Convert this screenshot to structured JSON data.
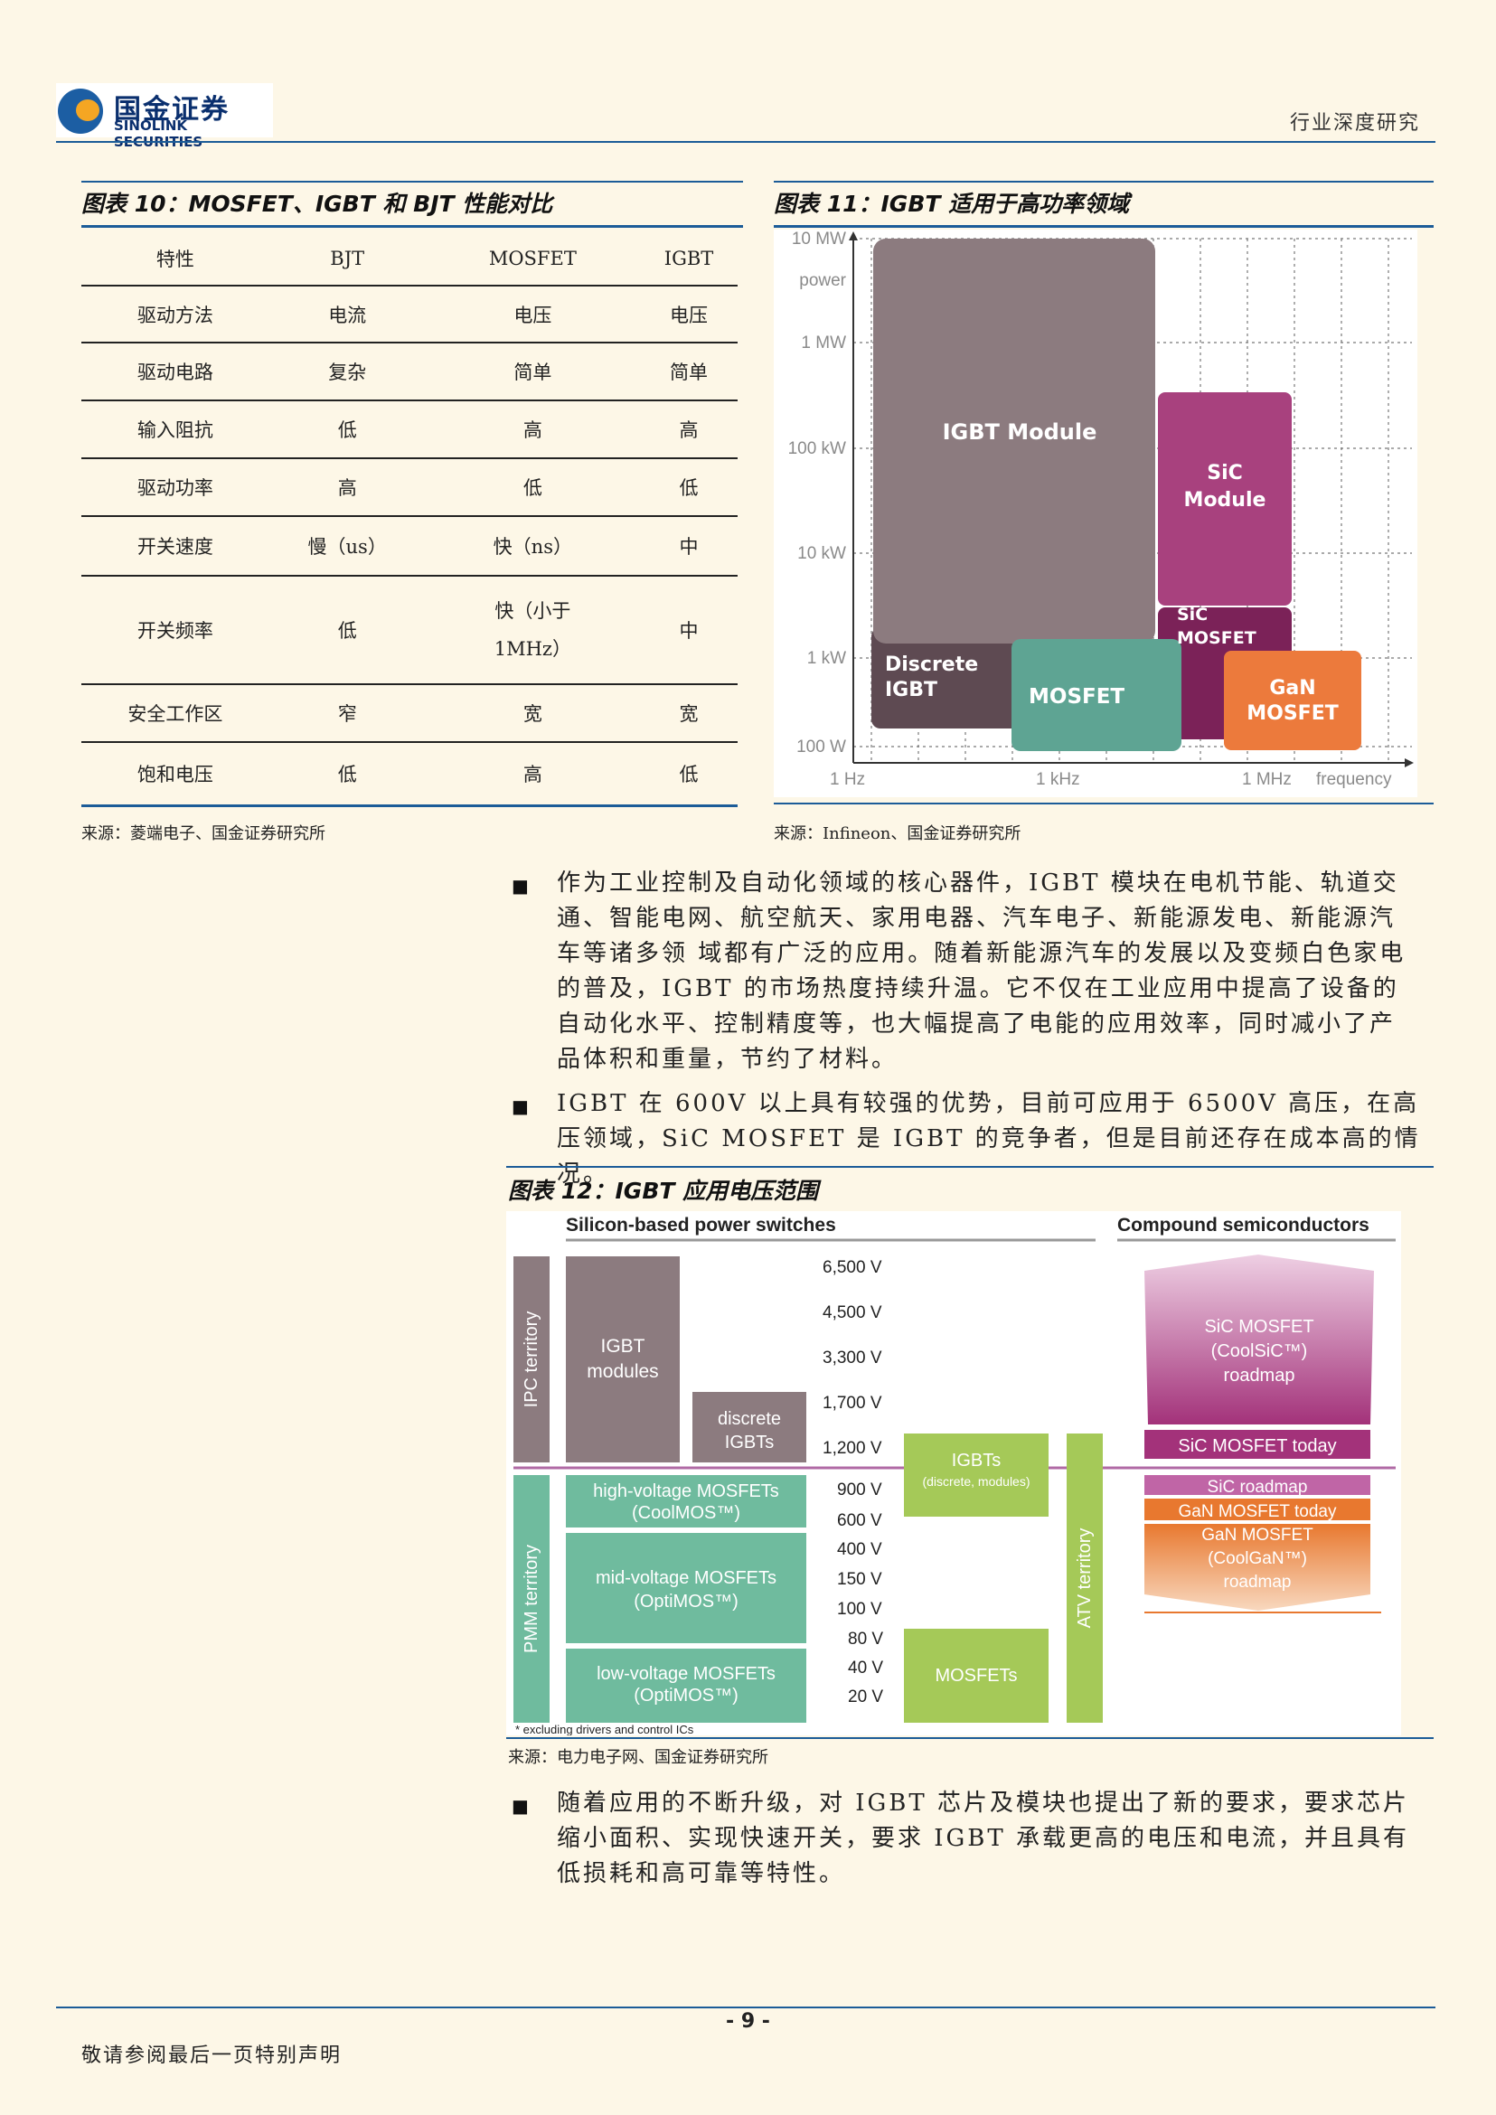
{
  "header": {
    "logo_cn": "国金证券",
    "logo_en": "SINOLINK SECURITIES",
    "right_text": "行业深度研究"
  },
  "figure10": {
    "title": "图表 10：MOSFET、IGBT 和 BJT 性能对比",
    "columns": [
      "特性",
      "BJT",
      "MOSFET",
      "IGBT"
    ],
    "rows": [
      [
        "驱动方法",
        "电流",
        "电压",
        "电压"
      ],
      [
        "驱动电路",
        "复杂",
        "简单",
        "简单"
      ],
      [
        "输入阻抗",
        "低",
        "高",
        "高"
      ],
      [
        "驱动功率",
        "高",
        "低",
        "低"
      ],
      [
        "开关速度",
        "慢（us）",
        "快（ns）",
        "中"
      ],
      [
        "开关频率",
        "低",
        "快（小于 1MHz）",
        "中"
      ],
      [
        "安全工作区",
        "窄",
        "宽",
        "宽"
      ],
      [
        "饱和电压",
        "低",
        "高",
        "低"
      ]
    ],
    "source": "来源：菱端电子、国金证券研究所"
  },
  "figure11": {
    "title": "图表 11：IGBT 适用于高功率领域",
    "source": "来源：Infineon、国金证券研究所",
    "y_axis_label": "power",
    "x_axis_label": "frequency",
    "y_ticks": [
      "10 MW",
      "1 MW",
      "100 kW",
      "10 kW",
      "1 kW",
      "100 W"
    ],
    "x_ticks": [
      "1 Hz",
      "1 kHz",
      "1 MHz"
    ],
    "blocks": [
      {
        "label": "IGBT Module",
        "color": "#8c7b7f"
      },
      {
        "label": "SiC Module",
        "color": "#a8417e"
      },
      {
        "label": "Discrete IGBT",
        "color": "#5e4a52"
      },
      {
        "label": "MOSFET",
        "color": "#5ea493"
      },
      {
        "label": "SiC MOSFET",
        "color": "#7b2258"
      },
      {
        "label": "GaN MOSFET",
        "color": "#ec7a3c"
      }
    ]
  },
  "paragraphs": [
    "作为工业控制及自动化领域的核心器件，IGBT 模块在电机节能、轨道交通、智能电网、航空航天、家用电器、汽车电子、新能源发电、新能源汽车等诸多领 域都有广泛的应用。随着新能源汽车的发展以及变频白色家电的普及，IGBT 的市场热度持续升温。它不仅在工业应用中提高了设备的自动化水平、控制精度等，也大幅提高了电能的应用效率，同时减小了产品体积和重量，节约了材料。",
    "IGBT 在 600V 以上具有较强的优势，目前可应用于 6500V 高压，在高压领域，SiC MOSFET 是 IGBT 的竞争者，但是目前还存在成本高的情况。",
    "随着应用的不断升级，对 IGBT 芯片及模块也提出了新的要求，要求芯片缩小面积、实现快速开关，要求 IGBT 承载更高的电压和电流，并且具有低损耗和高可靠等特性。"
  ],
  "figure12": {
    "title": "图表 12：IGBT 应用电压范围",
    "source": "来源：电力电子网、国金证券研究所",
    "heading_left": "Silicon-based power switches",
    "heading_right": "Compound semiconductors",
    "voltages": [
      "6,500 V",
      "4,500 V",
      "3,300 V",
      "1,700 V",
      "1,200 V",
      "900 V",
      "600 V",
      "400 V",
      "150 V",
      "100 V",
      "80 V",
      "40 V",
      "20 V"
    ],
    "ipc": "IPC territory",
    "pmm": "PMM territory",
    "atv": "ATV territory",
    "igbt_modules": "IGBT modules",
    "discrete_igbts": "discrete IGBTs",
    "hv_mosfets": "high-voltage MOSFETs (CoolMOS™)",
    "mv_mosfets": "mid-voltage MOSFETs (OptiMOS™)",
    "lv_mosfets": "low-voltage MOSFETs (OptiMOS™)",
    "igbts": "IGBTs",
    "igbts_sub": "(discrete, modules)",
    "mosfets": "MOSFETs",
    "sic_roadmap_big": "SiC MOSFET (CoolSiC™) roadmap",
    "sic_today": "SiC MOSFET today",
    "sic_roadmap": "SiC roadmap",
    "gan_today": "GaN MOSFET today",
    "gan_roadmap": "GaN MOSFET (CoolGaN™) roadmap",
    "footnote": "* excluding drivers and control ICs"
  },
  "footer": {
    "page": "- 9 -",
    "notice": "敬请参阅最后一页特别声明"
  }
}
